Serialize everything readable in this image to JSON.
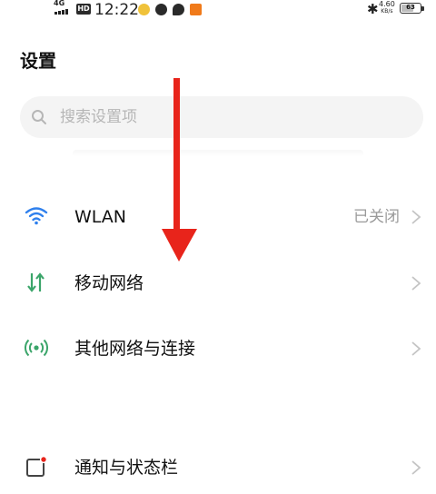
{
  "status_bar": {
    "network": "4G",
    "hd": "HD",
    "time": "12:22",
    "speed_value": "4.60",
    "speed_unit": "KB/s",
    "battery": "63",
    "bluetooth_icon": "bluetooth-icon"
  },
  "page": {
    "title": "设置"
  },
  "search": {
    "placeholder": "搜索设置项"
  },
  "settings": {
    "wlan": {
      "label": "WLAN",
      "value": "已关闭",
      "icon": "wifi-icon"
    },
    "mobile_network": {
      "label": "移动网络",
      "icon": "mobile-data-icon"
    },
    "other_networks": {
      "label": "其他网络与连接",
      "icon": "connection-icon"
    },
    "notifications": {
      "label": "通知与状态栏",
      "icon": "notification-icon"
    }
  },
  "colors": {
    "accent_blue": "#2f80ed",
    "accent_green": "#3ba56a",
    "arrow_red": "#e8241b"
  }
}
